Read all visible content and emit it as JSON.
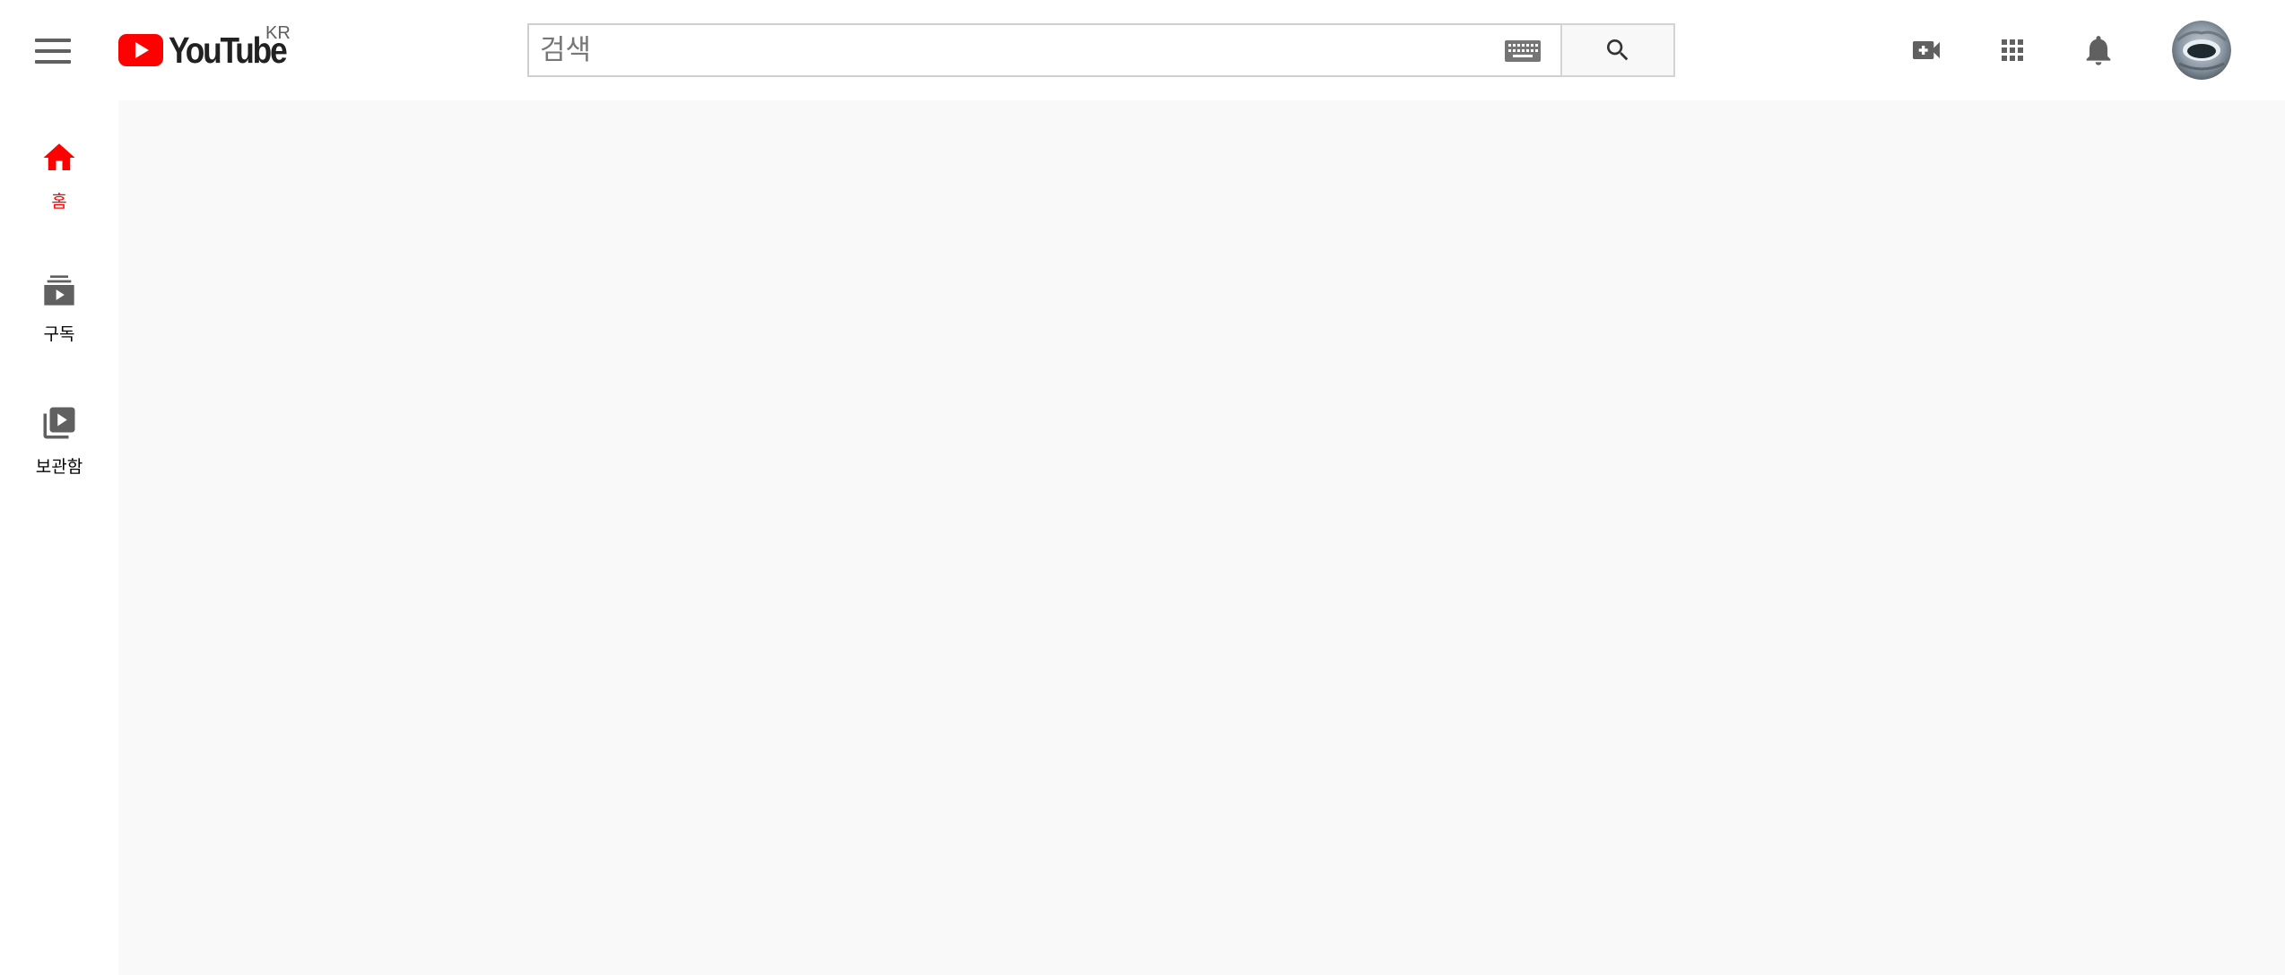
{
  "masthead": {
    "logo_text": "YouTube",
    "country_code": "KR",
    "search": {
      "placeholder": "검색",
      "value": ""
    },
    "icons": [
      "menu-icon",
      "keyboard-icon",
      "search-icon",
      "create-video-icon",
      "apps-icon",
      "notifications-icon",
      "avatar"
    ]
  },
  "sidebar": {
    "items": [
      {
        "label": "홈",
        "icon": "home-icon",
        "active": true
      },
      {
        "label": "구독",
        "icon": "subscriptions-icon",
        "active": false
      },
      {
        "label": "보관함",
        "icon": "library-icon",
        "active": false
      }
    ]
  },
  "colors": {
    "brand_red": "#ff0000",
    "icon_gray": "#606060",
    "content_bg": "#f9f9f9"
  }
}
